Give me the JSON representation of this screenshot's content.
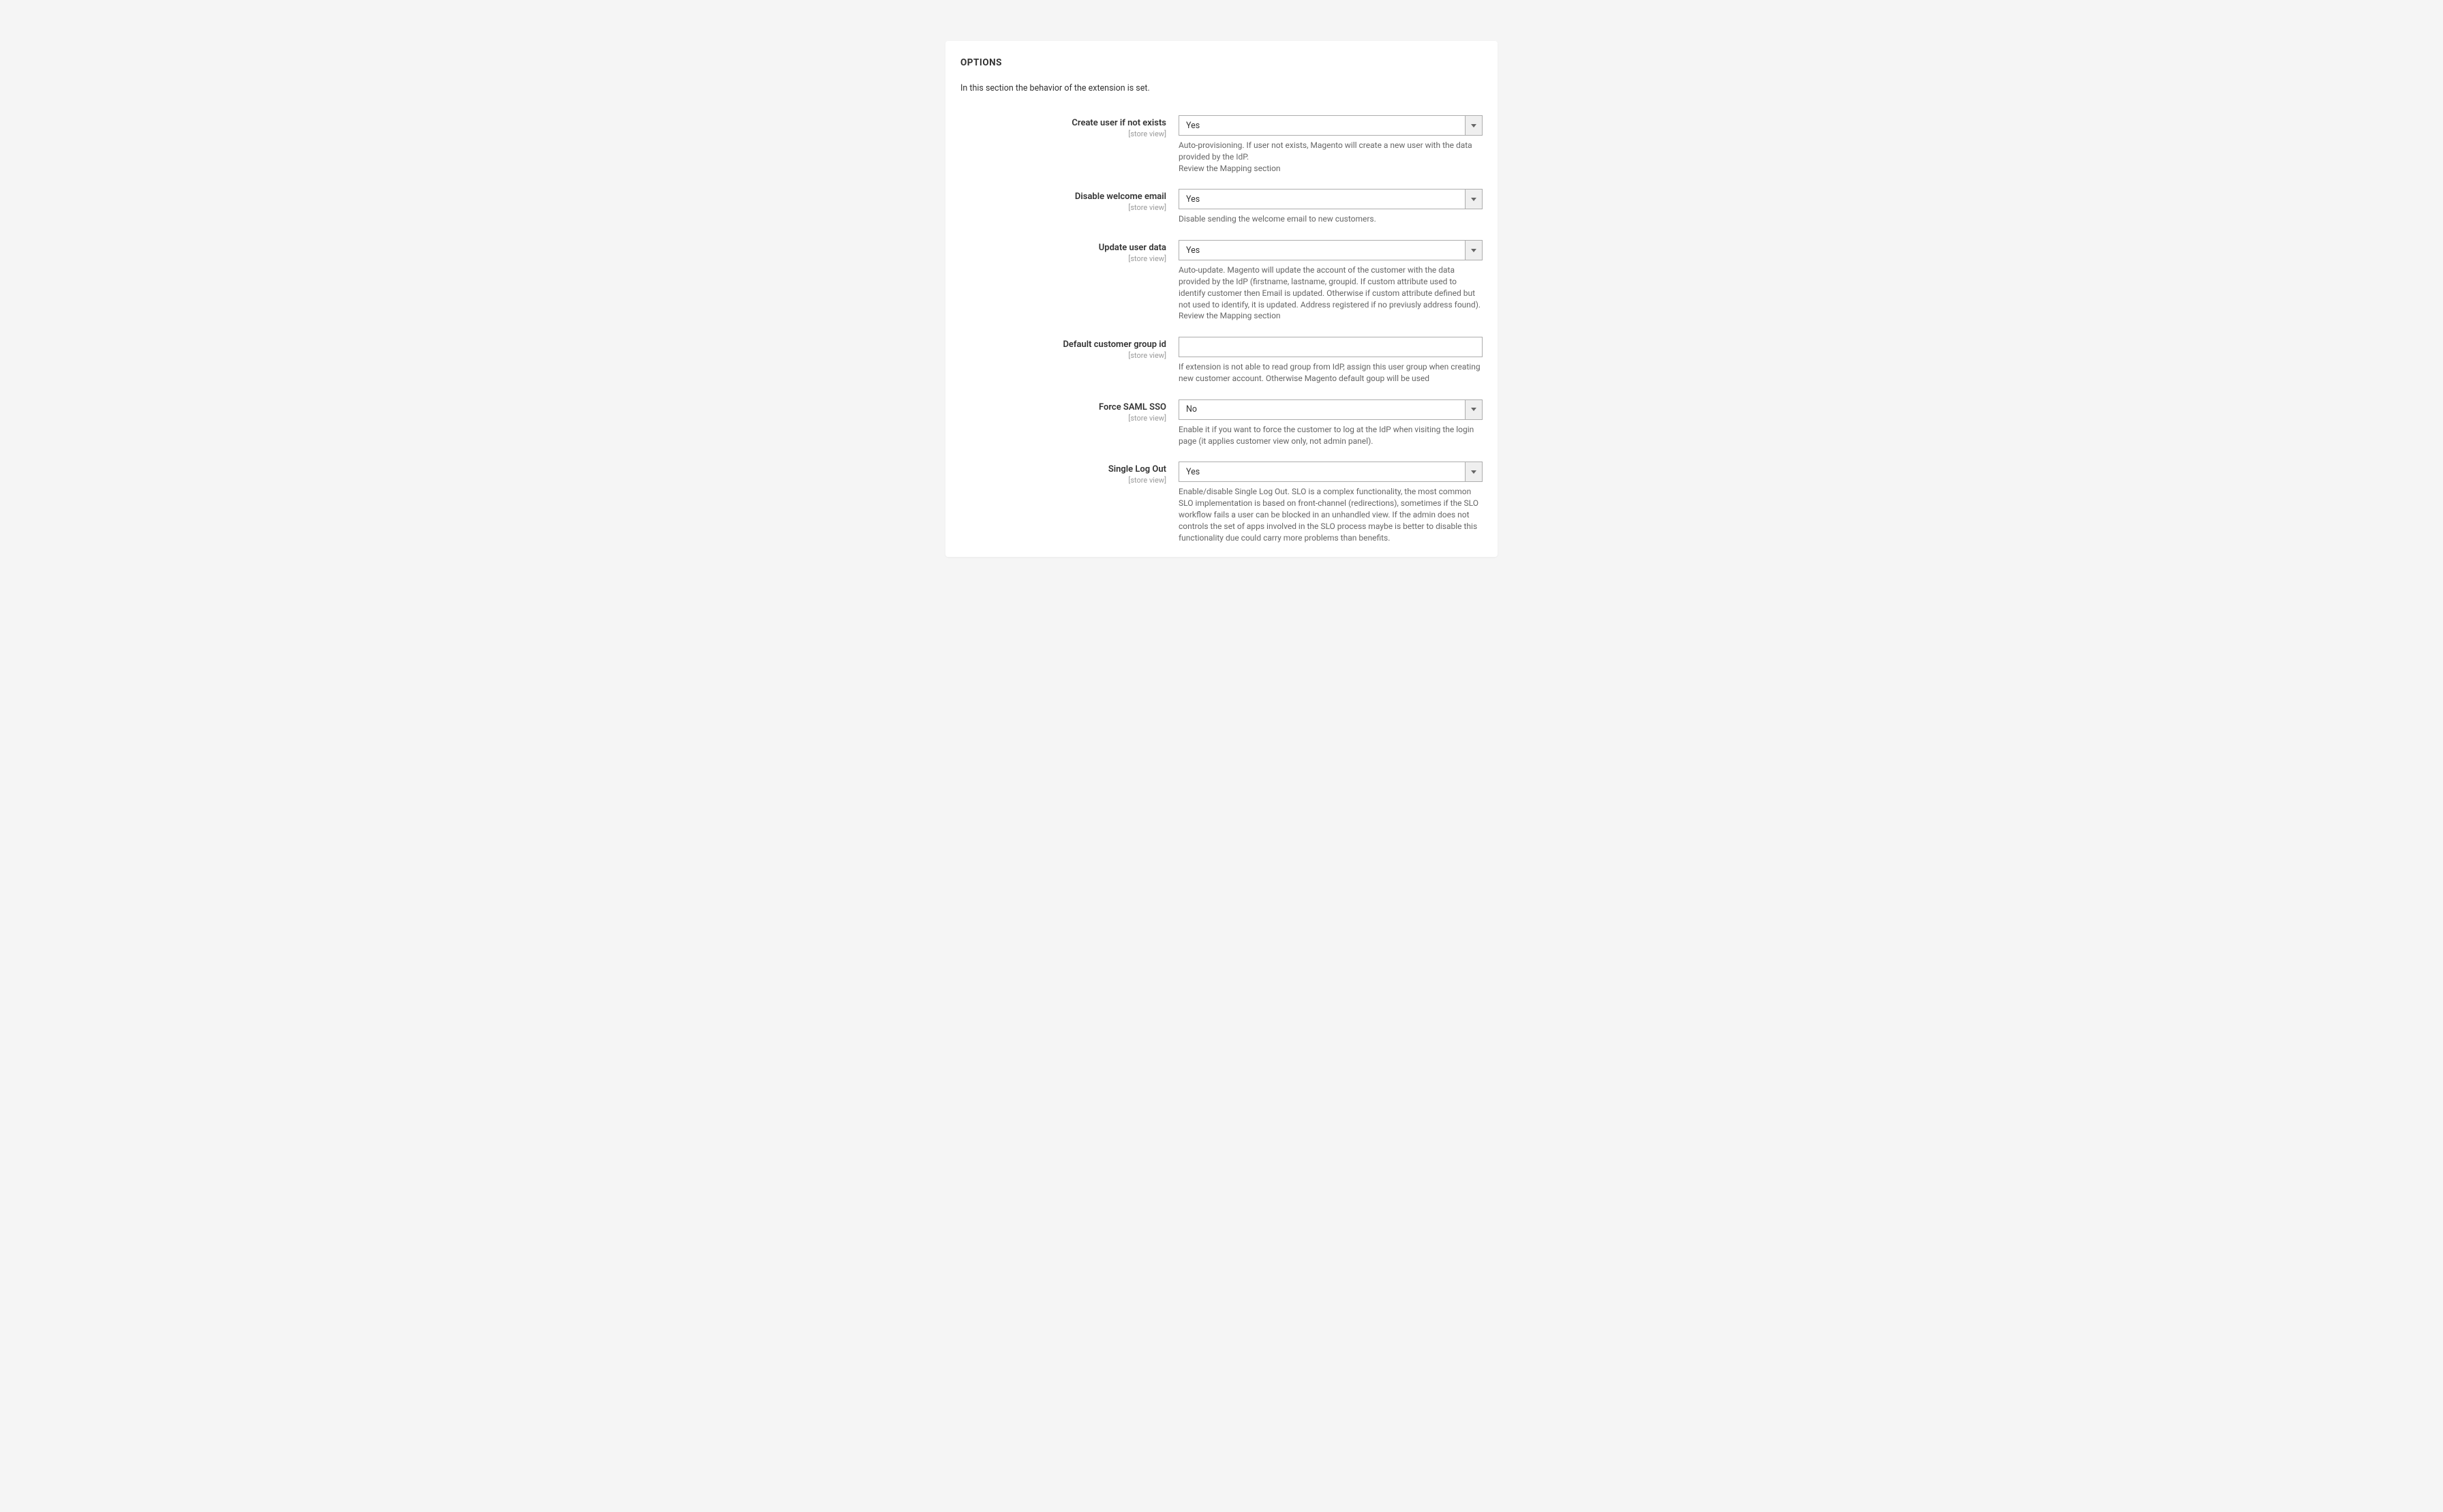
{
  "panel": {
    "title": "OPTIONS",
    "description": "In this section the behavior of the extension is set."
  },
  "fields": {
    "createUser": {
      "label": "Create user if not exists",
      "scope": "[store view]",
      "value": "Yes",
      "hint": "Auto-provisioning. If user not exists, Magento will create a new user with the data provided by the IdP.\nReview the Mapping section"
    },
    "disableWelcome": {
      "label": "Disable welcome email",
      "scope": "[store view]",
      "value": "Yes",
      "hint": "Disable sending the welcome email to new customers."
    },
    "updateUser": {
      "label": "Update user data",
      "scope": "[store view]",
      "value": "Yes",
      "hint": "Auto-update. Magento will update the account of the customer with the data provided by the IdP (firstname, lastname, groupid. If custom attribute used to identify customer then Email is updated. Otherwise if custom attribute defined but not used to identify, it is updated. Address registered if no previusly address found).\nReview the Mapping section"
    },
    "defaultGroup": {
      "label": "Default customer group id",
      "scope": "[store view]",
      "value": "",
      "hint": "If extension is not able to read group from IdP, assign this user group when creating new customer account. Otherwise Magento default goup will be used"
    },
    "forceSaml": {
      "label": "Force SAML SSO",
      "scope": "[store view]",
      "value": "No",
      "hint": "Enable it if you want to force the customer to log at the IdP when visiting the login page (it applies customer view only, not admin panel)."
    },
    "slo": {
      "label": "Single Log Out",
      "scope": "[store view]",
      "value": "Yes",
      "hint": "Enable/disable Single Log Out. SLO is a complex functionality, the most common SLO implementation is based on front-channel (redirections), sometimes if the SLO workflow fails a user can be blocked in an unhandled view. If the admin does not controls the set of apps involved in the SLO process maybe is better to disable this functionality due could carry more problems than benefits."
    }
  }
}
